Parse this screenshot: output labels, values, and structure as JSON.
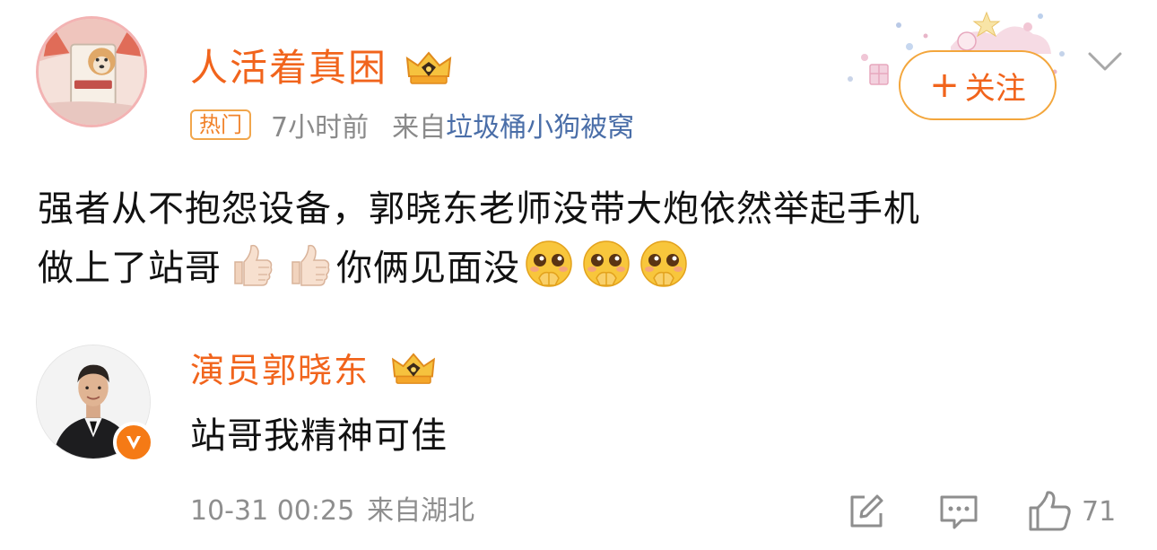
{
  "post": {
    "author": {
      "name": "人活着真困",
      "avatar": "shiba-dog-in-box-avatar",
      "badge_icon": "crown-icon"
    },
    "hot_label": "热门",
    "time": "7小时前",
    "from_label": "来自",
    "source": "垃圾桶小狗被窝",
    "follow_label": "关注",
    "follow_plus": "+",
    "text_line1": "强者从不抱怨设备，郭晓东老师没带大炮依然举起手机",
    "text_line2_part1": "做上了站哥",
    "text_line2_part2": "你俩见面没",
    "emojis_line2_a": [
      "thumbs-up-icon",
      "thumbs-up-icon"
    ],
    "emojis_line2_b": [
      "pleading-face-icon",
      "pleading-face-icon",
      "pleading-face-icon"
    ]
  },
  "reply": {
    "author": {
      "name": "演员郭晓东",
      "avatar": "man-in-suit-avatar",
      "badge_icon": "crown-icon",
      "verified_icon": "verified-v-icon"
    },
    "text": "站哥我精神可佳",
    "date": "10-31 00:25",
    "from": "来自湖北",
    "actions": {
      "share_icon": "share-icon",
      "comment_icon": "comment-icon",
      "like_icon": "thumbs-up-outline-icon",
      "like_count": "71"
    }
  },
  "colors": {
    "username": "#f1641c",
    "source_link": "#4a6ea8",
    "meta_gray": "#8a8a8a",
    "hot_border": "#f1a64c",
    "follow_border": "#f3a63c",
    "verified_bg": "#f57a15"
  }
}
